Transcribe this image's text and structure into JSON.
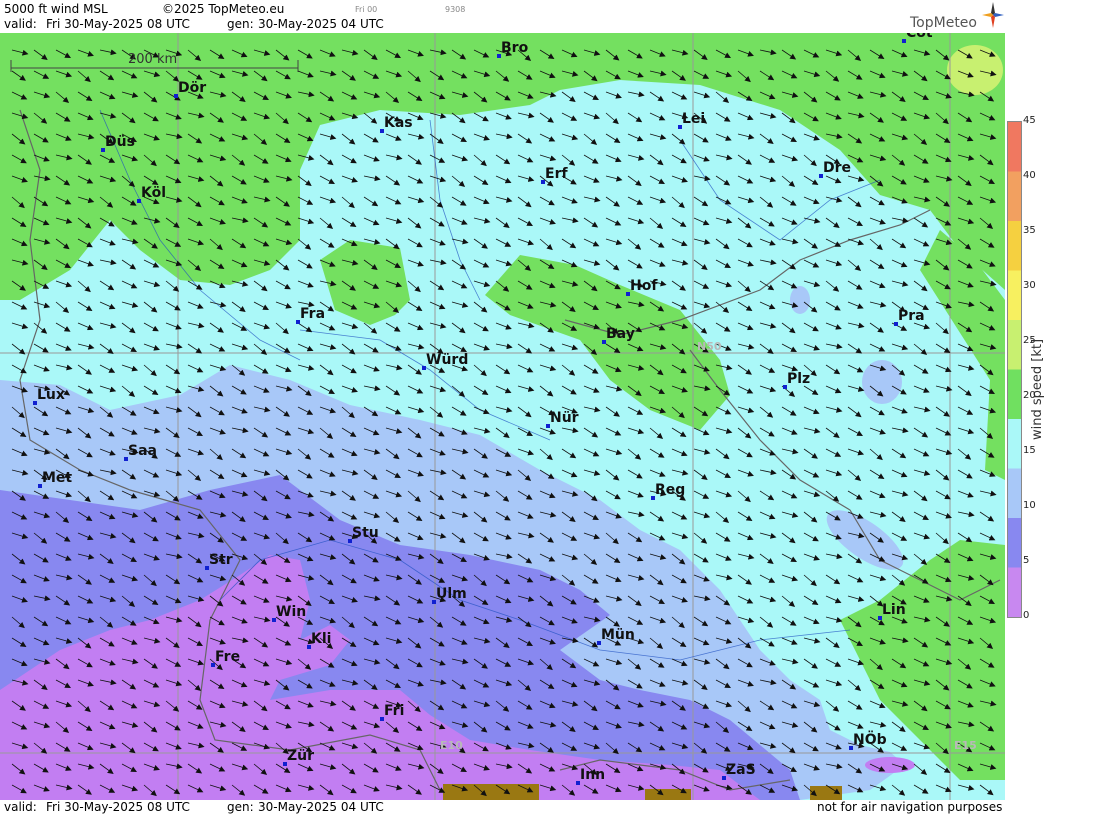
{
  "header": {
    "product": "5000 ft wind MSL",
    "copyright": "©2025 TopMeteo.eu",
    "small1": "Fri 00",
    "small2": "9308",
    "valid_label": "valid:",
    "valid_value": "Fri  30-May-2025  08 UTC",
    "gen_label": "gen:",
    "gen_value": "30-May-2025 04 UTC",
    "logo": "TopMeteo"
  },
  "map": {
    "scale_label": "200 km",
    "grid_labels": [
      "N50",
      "E10",
      "E15"
    ],
    "cities": [
      {
        "name": "Mün",
        "id": "munster"
      },
      {
        "name": "Bro",
        "id": "brocken"
      },
      {
        "name": "Cot",
        "id": "cottbus"
      },
      {
        "name": "Dör",
        "id": "dortmund"
      },
      {
        "name": "Düs",
        "id": "dusseldorf"
      },
      {
        "name": "Kas",
        "id": "kassel"
      },
      {
        "name": "Lei",
        "id": "leipzig"
      },
      {
        "name": "Erf",
        "id": "erfurt"
      },
      {
        "name": "Dre",
        "id": "dresden"
      },
      {
        "name": "Köl",
        "id": "koln"
      },
      {
        "name": "Hof",
        "id": "hof"
      },
      {
        "name": "Fra",
        "id": "frankfurt"
      },
      {
        "name": "Pra",
        "id": "praha"
      },
      {
        "name": "Bay",
        "id": "bayreuth"
      },
      {
        "name": "Würd",
        "id": "wurzburg"
      },
      {
        "name": "Plz",
        "id": "plzen"
      },
      {
        "name": "Lux",
        "id": "luxembourg"
      },
      {
        "name": "Nür",
        "id": "nurnberg"
      },
      {
        "name": "Saa",
        "id": "saarbrucken"
      },
      {
        "name": "Met",
        "id": "metz"
      },
      {
        "name": "Reg",
        "id": "regensburg"
      },
      {
        "name": "Stu",
        "id": "stuttgart"
      },
      {
        "name": "Str",
        "id": "strasbourg"
      },
      {
        "name": "Ulm",
        "id": "ulm"
      },
      {
        "name": "Win",
        "id": "winterberg"
      },
      {
        "name": "Kli",
        "id": "klippeneck"
      },
      {
        "name": "Lin",
        "id": "linz"
      },
      {
        "name": "Mün",
        "id": "munchen"
      },
      {
        "name": "Fre",
        "id": "freiburg"
      },
      {
        "name": "Fri",
        "id": "friedrichshafen"
      },
      {
        "name": "NÖb",
        "id": "nob"
      },
      {
        "name": "Zür",
        "id": "zurich"
      },
      {
        "name": "ZaS",
        "id": "zas"
      },
      {
        "name": "Inn",
        "id": "innsbruck"
      }
    ]
  },
  "legend": {
    "title": "wind speed [kt]",
    "ticks": [
      "45",
      "40",
      "35",
      "30",
      "25",
      "20",
      "15",
      "10",
      "5",
      "0"
    ],
    "colors": [
      "#f07860",
      "#f2a060",
      "#f5d040",
      "#f7f060",
      "#c8f070",
      "#70e060",
      "#aaf8f8",
      "#a8c8f8",
      "#8888f0",
      "#c888f0"
    ]
  },
  "footer": {
    "valid_label": "valid:",
    "valid_value": "Fri  30-May-2025  08 UTC",
    "gen_label": "gen:",
    "gen_value": "30-May-2025 04 UTC",
    "disclaimer": "not for air navigation purposes"
  }
}
